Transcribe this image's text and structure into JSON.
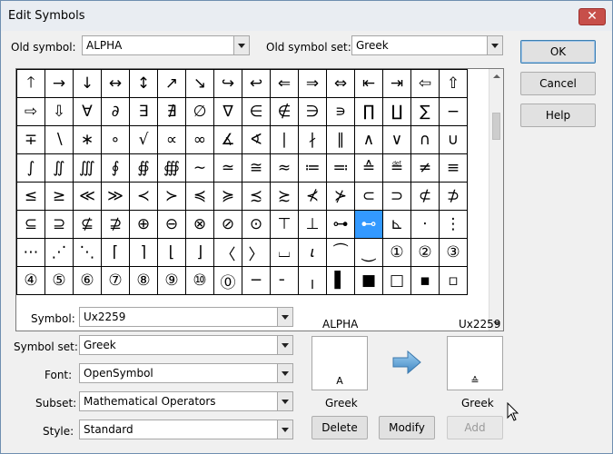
{
  "window": {
    "title": "Edit Symbols",
    "close_glyph": "✕"
  },
  "old_symbol": {
    "label": "Old symbol:",
    "value": "ALPHA"
  },
  "old_symbol_set": {
    "label": "Old symbol set:",
    "value": "Greek"
  },
  "buttons": {
    "ok": "OK",
    "cancel": "Cancel",
    "help": "Help",
    "delete": "Delete",
    "modify": "Modify",
    "add": "Add"
  },
  "grid": {
    "selected": {
      "row": 5,
      "col": 12
    },
    "rows": [
      [
        "🡑",
        "→",
        "↓",
        "↔",
        "↕",
        "↗",
        "↘",
        "↪",
        "↩",
        "⇐",
        "⇒",
        "⇔",
        "⇤",
        "⇥",
        "⇦",
        "⇧"
      ],
      [
        "⇨",
        "⇩",
        "∀",
        "∂",
        "∃",
        "∄",
        "∅",
        "∇",
        "∈",
        "∉",
        "∋",
        "∍",
        "∏",
        "∐",
        "∑",
        "−"
      ],
      [
        "∓",
        "∖",
        "∗",
        "∘",
        "√",
        "∝",
        "∞",
        "∡",
        "∢",
        "∣",
        "∤",
        "∥",
        "∧",
        "∨",
        "∩",
        "∪"
      ],
      [
        "∫",
        "∬",
        "∭",
        "∮",
        "∯",
        "∰",
        "∼",
        "≃",
        "≅",
        "≈",
        "≔",
        "≕",
        "≙",
        "≝",
        "≠",
        "≡"
      ],
      [
        "≤",
        "≥",
        "≪",
        "≫",
        "≺",
        "≻",
        "≼",
        "≽",
        "≾",
        "≿",
        "⊀",
        "⊁",
        "⊂",
        "⊃",
        "⊄",
        "⊅"
      ],
      [
        "⊆",
        "⊇",
        "⊈",
        "⊉",
        "⊕",
        "⊖",
        "⊗",
        "⊘",
        "⊙",
        "⊤",
        "⊥",
        "⊶",
        "⊷",
        "⊾",
        "⋅",
        "⋮"
      ],
      [
        "⋯",
        "⋰",
        "⋱",
        "⌈",
        "⌉",
        "⌊",
        "⌋",
        "〈",
        "〉",
        "⌴",
        "𝜄",
        "⏜",
        "⏝",
        "①",
        "②",
        "③"
      ],
      [
        "④",
        "⑤",
        "⑥",
        "⑦",
        "⑧",
        "⑨",
        "⑩",
        "⓪",
        "─",
        "╴",
        "╷",
        "▌",
        "■",
        "□",
        "▪",
        "▫"
      ]
    ]
  },
  "fields": {
    "symbol": {
      "label": "Symbol:",
      "value": "Ux2259"
    },
    "symbol_set": {
      "label": "Symbol set:",
      "value": "Greek"
    },
    "font": {
      "label": "Font:",
      "value": "OpenSymbol"
    },
    "subset": {
      "label": "Subset:",
      "value": "Mathematical Operators"
    },
    "style": {
      "label": "Style:",
      "value": "Standard"
    }
  },
  "old_preview": {
    "name": "ALPHA",
    "char": "A",
    "set": "Greek"
  },
  "new_preview": {
    "name": "Ux2259",
    "char": "≙",
    "set": "Greek"
  },
  "colors": {
    "selection": "#3399ff",
    "arrow": "#4f95cf"
  },
  "icons": {
    "replace_arrow": "right-arrow-icon",
    "mouse_cursor": "mouse-cursor-icon"
  }
}
